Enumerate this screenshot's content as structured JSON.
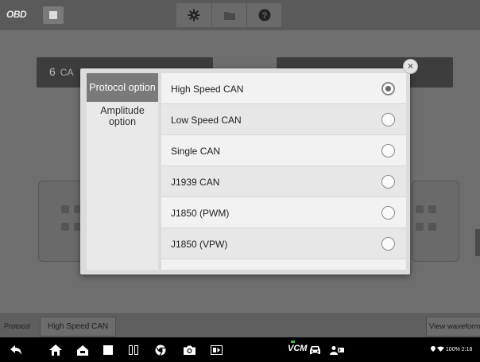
{
  "topbar": {
    "logo": "OBD",
    "buttons": [
      {
        "icon": "gear-icon"
      },
      {
        "icon": "folder-icon"
      },
      {
        "icon": "help-icon"
      }
    ]
  },
  "background": {
    "card_left_number": "6",
    "card_left_text": "CA"
  },
  "dialog": {
    "tabs": [
      {
        "label": "Protocol option",
        "active": true
      },
      {
        "label": "Amplitude option",
        "active": false
      }
    ],
    "options": [
      {
        "label": "High Speed CAN",
        "selected": true
      },
      {
        "label": "Low Speed CAN",
        "selected": false
      },
      {
        "label": "Single CAN",
        "selected": false
      },
      {
        "label": "J1939 CAN",
        "selected": false
      },
      {
        "label": "J1850 (PWM)",
        "selected": false
      },
      {
        "label": "J1850 (VPW)",
        "selected": false
      }
    ],
    "close_symbol": "×"
  },
  "protocol_bar": {
    "label": "Protocol",
    "value": "High Speed CAN",
    "view_waveform": "View waveform"
  },
  "navbar": {
    "vcm_label": "VCM",
    "status_text": "100% 2:18",
    "icons": [
      "back-icon",
      "home-icon",
      "house-icon",
      "recent-apps-icon",
      "split-screen-icon",
      "chrome-icon",
      "camera-icon",
      "screen-record-icon",
      "vcm-icon",
      "car-icon",
      "remote-expert-icon"
    ]
  },
  "colors": {
    "accent_selected": "#7a7a7a",
    "dialog_bg": "#dcdcdc",
    "navbar_bg": "#000000"
  }
}
